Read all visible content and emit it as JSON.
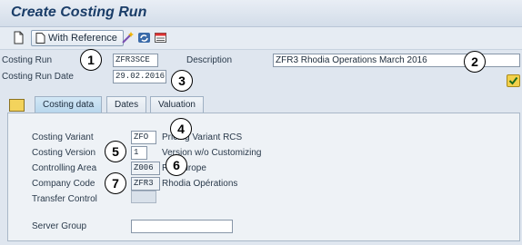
{
  "window": {
    "title": "Create Costing Run"
  },
  "toolbar": {
    "with_reference_label": "With Reference"
  },
  "header": {
    "costing_run_label": "Costing Run",
    "costing_run_value": "ZFR3SCE",
    "description_label": "Description",
    "description_value": "ZFR3 Rhodia Operations March 2016",
    "costing_run_date_label": "Costing Run Date",
    "costing_run_date_value": "29.02.2016"
  },
  "tabs": [
    {
      "label": "Costing data",
      "active": true
    },
    {
      "label": "Dates",
      "active": false
    },
    {
      "label": "Valuation",
      "active": false
    }
  ],
  "costing_data": {
    "costing_variant_label": "Costing Variant",
    "costing_variant_value": "ZFO",
    "costing_variant_desc": "Pricing Variant  RCS",
    "costing_version_label": "Costing Version",
    "costing_version_value": "1",
    "costing_version_desc": "Version w/o Customizing",
    "controlling_area_label": "Controlling Area",
    "controlling_area_value": "Z006",
    "controlling_area_desc": "RB Europe",
    "company_code_label": "Company Code",
    "company_code_value": "ZFR3",
    "company_code_desc": "Rhodia Opérations",
    "transfer_control_label": "Transfer Control",
    "transfer_control_value": "",
    "server_group_label": "Server Group",
    "server_group_value": ""
  },
  "annotations": [
    "1",
    "2",
    "3",
    "4",
    "5",
    "6",
    "7"
  ],
  "colors": {
    "title": "#1a3d68",
    "active_tab": "#b6d6ec",
    "panel": "#eef2f6"
  }
}
